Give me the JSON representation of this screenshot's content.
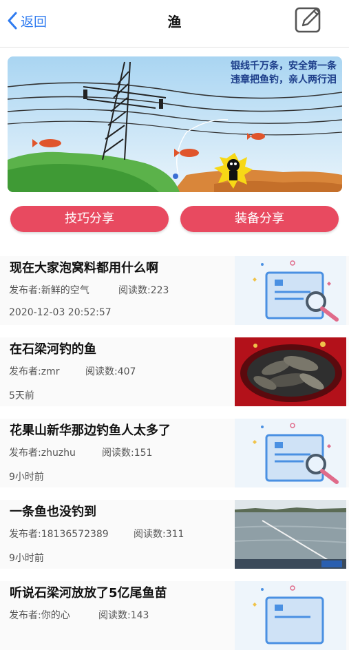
{
  "nav": {
    "back_label": "返回",
    "title": "渔"
  },
  "banner": {
    "caption_line1": "银线千万条，安全第一条",
    "caption_line2": "违章把鱼钓，亲人两行泪"
  },
  "tabs": {
    "tips": "技巧分享",
    "gear": "装备分享"
  },
  "posts": [
    {
      "title": "现在大家泡窝料都用什么啊",
      "author": "发布者:新鲜的空气",
      "reads": "阅读数:223",
      "time": "2020-12-03 20:52:57",
      "thumb": "document-search-icon"
    },
    {
      "title": "在石梁河钓的鱼",
      "author": "发布者:zmr",
      "reads": "阅读数:407",
      "time": "5天前",
      "thumb": "fish-catch-photo"
    },
    {
      "title": "花果山新华那边钓鱼人太多了",
      "author": "发布者:zhuzhu",
      "reads": "阅读数:151",
      "time": "9小时前",
      "thumb": "document-search-icon"
    },
    {
      "title": "一条鱼也没钓到",
      "author": "发布者:18136572389",
      "reads": "阅读数:311",
      "time": "9小时前",
      "thumb": "river-fishing-photo"
    },
    {
      "title": "听说石梁河放放了5亿尾鱼苗",
      "author": "发布者:你的心",
      "reads": "阅读数:143",
      "time": "",
      "thumb": "document-search-icon"
    }
  ],
  "colors": {
    "accent": "#e84a60",
    "link": "#2f7bf0"
  }
}
